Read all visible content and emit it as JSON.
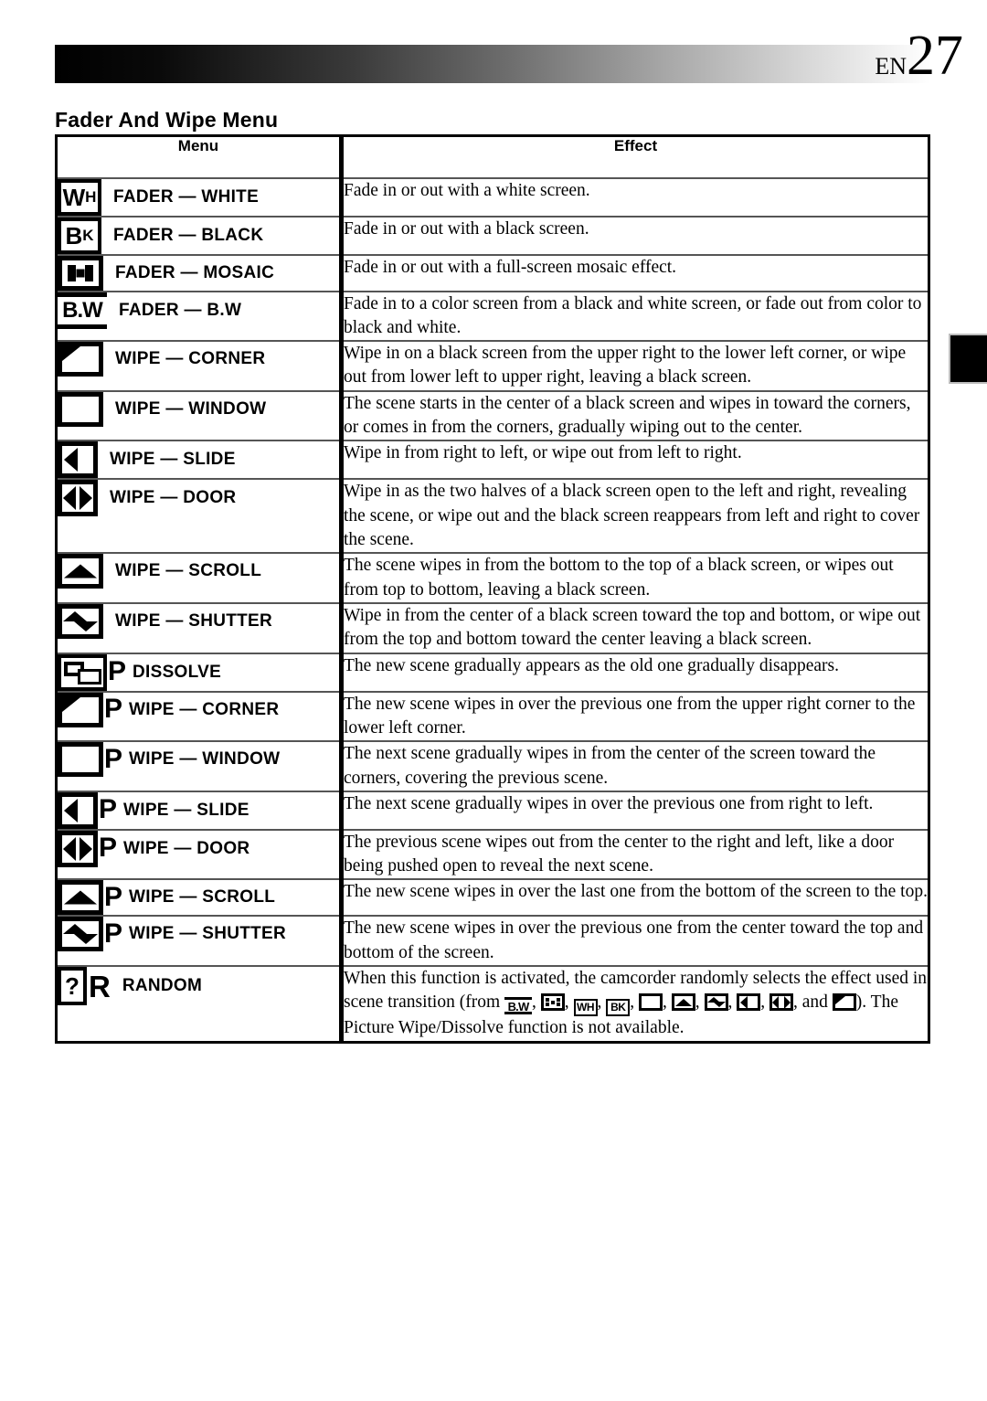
{
  "page": {
    "locale_code": "EN",
    "page_number": "27",
    "section_title": "Fader And Wipe Menu"
  },
  "table": {
    "headers": [
      "Menu",
      "Effect"
    ],
    "rows": [
      {
        "icon": "fader-white-icon",
        "icon_text": "WH",
        "label": "FADER — WHITE",
        "effect": "Fade in or out with a white screen."
      },
      {
        "icon": "fader-black-icon",
        "icon_text": "BK",
        "label": "FADER — BLACK",
        "effect": "Fade in or out with a black screen."
      },
      {
        "icon": "fader-mosaic-icon",
        "icon_text": "",
        "label": "FADER — MOSAIC",
        "effect": "Fade in or out with a full-screen mosaic effect."
      },
      {
        "icon": "fader-bw-icon",
        "icon_text": "B.W",
        "label": "FADER — B.W",
        "effect": "Fade in to a color screen from a black and white screen, or fade out from color to black and white."
      },
      {
        "icon": "wipe-corner-icon",
        "icon_text": "",
        "label": "WIPE — CORNER",
        "effect": "Wipe in on a black screen from the upper right to the lower left corner, or wipe out from lower left to upper right, leaving a black screen."
      },
      {
        "icon": "wipe-window-icon",
        "icon_text": "",
        "label": "WIPE — WINDOW",
        "effect": "The scene starts in the center of a black screen and wipes in toward the corners, or comes in from the corners, gradually wiping out to the center."
      },
      {
        "icon": "wipe-slide-icon",
        "icon_text": "",
        "label": "WIPE — SLIDE",
        "effect": "Wipe in from right to left, or wipe out from left to right."
      },
      {
        "icon": "wipe-door-icon",
        "icon_text": "",
        "label": "WIPE — DOOR",
        "effect": "Wipe in as the two halves of a black screen open to the left and right, revealing the scene, or wipe out and the black screen reappears from left and right to cover the scene."
      },
      {
        "icon": "wipe-scroll-icon",
        "icon_text": "",
        "label": "WIPE — SCROLL",
        "effect": "The scene wipes in from the bottom to the top of a black screen, or wipes out from top to bottom, leaving a black screen."
      },
      {
        "icon": "wipe-shutter-icon",
        "icon_text": "",
        "label": "WIPE — SHUTTER",
        "effect": "Wipe in from the center of a black screen toward the top and bottom, or wipe out from the top and bottom toward the center leaving a black screen."
      },
      {
        "icon": "dissolve-icon",
        "icon_text": "P",
        "label": "DISSOLVE",
        "effect": "The new scene gradually appears as the old one gradually disappears."
      },
      {
        "icon": "picture-wipe-corner-icon",
        "icon_text": "P",
        "label": "WIPE — CORNER",
        "effect": "The new scene wipes in over the previous one from the upper right corner to the lower left corner."
      },
      {
        "icon": "picture-wipe-window-icon",
        "icon_text": "P",
        "label": "WIPE — WINDOW",
        "effect": "The next scene gradually wipes in from the center of the screen toward the corners, covering the previous scene."
      },
      {
        "icon": "picture-wipe-slide-icon",
        "icon_text": "P",
        "label": "WIPE — SLIDE",
        "effect": "The next scene gradually wipes in over the previous one from right to left."
      },
      {
        "icon": "picture-wipe-door-icon",
        "icon_text": "P",
        "label": "WIPE — DOOR",
        "effect": "The previous scene wipes out from the center to the right and left, like a door being pushed open to reveal the next scene."
      },
      {
        "icon": "picture-wipe-scroll-icon",
        "icon_text": "P",
        "label": "WIPE — SCROLL",
        "effect": "The new scene wipes in over the last one from the bottom of the screen to the top."
      },
      {
        "icon": "picture-wipe-shutter-icon",
        "icon_text": "P",
        "label": "WIPE — SHUTTER",
        "effect": "The new scene wipes in over the previous one from the center toward the top and bottom of the screen."
      },
      {
        "icon": "random-icon",
        "icon_text": "?R",
        "label": "RANDOM",
        "effect": ""
      }
    ]
  },
  "random_effect": {
    "part1": "When this function is activated, the camcorder randomly selects the effect used in scene transition (from ",
    "sep": ", ",
    "and_word": ", and ",
    "part2": "). The Picture Wipe/Dissolve function is not available.",
    "inline_icon_texts": {
      "bw": "B.W",
      "wh": "WH",
      "bk": "BK"
    }
  },
  "colors": {
    "ink": "#000000",
    "rule": "#555555",
    "gradient_start": "#000000",
    "gradient_end": "#ffffff"
  }
}
